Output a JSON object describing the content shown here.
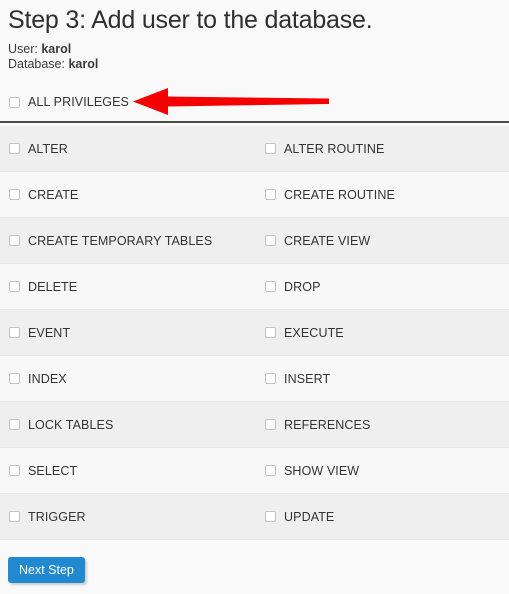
{
  "header": {
    "title": "Step 3: Add user to the database.",
    "user_label": "User:",
    "user_value": "karol",
    "database_label": "Database:",
    "database_value": "karol"
  },
  "master": {
    "label": "ALL PRIVILEGES",
    "checked": false
  },
  "annotation": {
    "arrow_color": "#f40000",
    "direction": "left",
    "points_to": "ALL PRIVILEGES"
  },
  "privileges": {
    "rows": [
      {
        "left": "ALTER",
        "right": "ALTER ROUTINE"
      },
      {
        "left": "CREATE",
        "right": "CREATE ROUTINE"
      },
      {
        "left": "CREATE TEMPORARY TABLES",
        "right": "CREATE VIEW"
      },
      {
        "left": "DELETE",
        "right": "DROP"
      },
      {
        "left": "EVENT",
        "right": "EXECUTE"
      },
      {
        "left": "INDEX",
        "right": "INSERT"
      },
      {
        "left": "LOCK TABLES",
        "right": "REFERENCES"
      },
      {
        "left": "SELECT",
        "right": "SHOW VIEW"
      },
      {
        "left": "TRIGGER",
        "right": "UPDATE"
      }
    ]
  },
  "footer": {
    "next_step_label": "Next Step"
  },
  "colors": {
    "accent": "#2089d0",
    "page_background": "#f9f9f9",
    "row_odd": "#efefef",
    "row_even": "#f8f8f8",
    "divider": "#4a4a4a",
    "arrow": "#f40000"
  }
}
